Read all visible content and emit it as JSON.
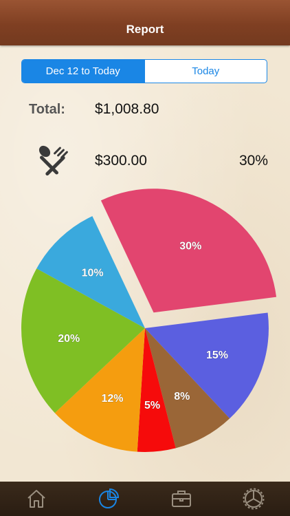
{
  "header": {
    "title": "Report"
  },
  "date_range": {
    "options": [
      {
        "label": "Dec 12 to Today",
        "selected": true
      },
      {
        "label": "Today",
        "selected": false
      }
    ]
  },
  "total": {
    "label": "Total:",
    "value": "$1,008.80"
  },
  "selected_category": {
    "icon": "spoon-fork-icon",
    "amount": "$300.00",
    "percent": "30%"
  },
  "chart_data": {
    "type": "pie",
    "slices": [
      {
        "label": "30%",
        "value": 30,
        "color": "#e2456f",
        "exploded": true
      },
      {
        "label": "15%",
        "value": 15,
        "color": "#5b5fe0"
      },
      {
        "label": "8%",
        "value": 8,
        "color": "#9a6637"
      },
      {
        "label": "5%",
        "value": 5,
        "color": "#f60b0b"
      },
      {
        "label": "12%",
        "value": 12,
        "color": "#f59d0f"
      },
      {
        "label": "20%",
        "value": 20,
        "color": "#7fbf24"
      },
      {
        "label": "10%",
        "value": 10,
        "color": "#3aa9dd"
      }
    ]
  },
  "tab_bar": {
    "items": [
      {
        "icon": "home-icon",
        "active": false
      },
      {
        "icon": "pie-chart-icon",
        "active": true
      },
      {
        "icon": "briefcase-icon",
        "active": false
      },
      {
        "icon": "settings-icon",
        "active": false
      }
    ]
  },
  "colors": {
    "accent": "#1a86e5",
    "nav_brown": "#7f3f22",
    "tab_inactive": "#9a8f80"
  }
}
